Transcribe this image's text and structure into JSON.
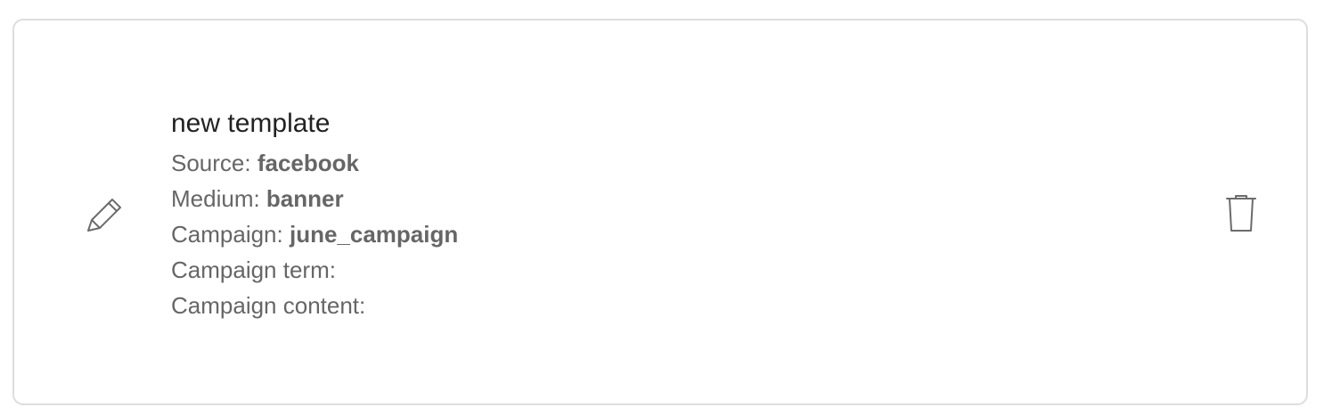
{
  "template": {
    "name": "new template",
    "fields": {
      "source": {
        "label": "Source: ",
        "value": "facebook"
      },
      "medium": {
        "label": "Medium: ",
        "value": "banner"
      },
      "campaign": {
        "label": "Campaign: ",
        "value": "june_campaign"
      },
      "term": {
        "label": "Campaign term: ",
        "value": ""
      },
      "content": {
        "label": "Campaign content: ",
        "value": ""
      }
    }
  },
  "icons": {
    "edit": "pencil-icon",
    "delete": "trash-icon"
  },
  "colors": {
    "border": "#dddddd",
    "title": "#222222",
    "text": "#666666",
    "icon": "#6b6b6b"
  }
}
